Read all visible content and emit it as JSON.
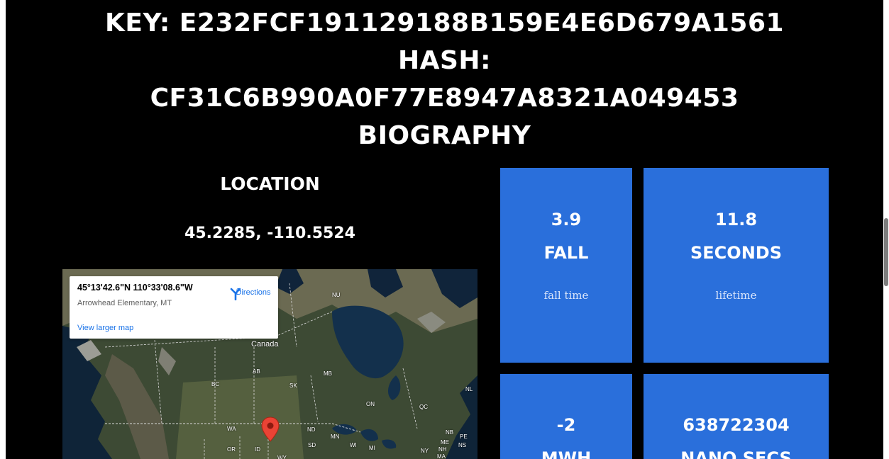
{
  "header": {
    "key_line": "KEY: E232FCF191129188B159E4E6D679A1561",
    "hash_label": "HASH:",
    "hash_value": "CF31C6B990A0F77E8947A8321A049453",
    "section_title": "BIOGRAPHY"
  },
  "location": {
    "title": "LOCATION",
    "coordinates": "45.2285, -110.5524"
  },
  "map": {
    "info_card": {
      "coords": "45°13'42.6\"N 110°33'08.6\"W",
      "place": "Arrowhead Elementary, MT",
      "directions_label": "Directions",
      "larger_map_link": "View larger map",
      "directions_icon": "directions-icon"
    },
    "labels": {
      "country": "Canada",
      "nu": "NU",
      "ab": "AB",
      "bc": "BC",
      "sk": "SK",
      "mb": "MB",
      "on": "ON",
      "qc": "QC",
      "nl": "NL",
      "nb": "NB",
      "pe": "PE",
      "ns": "NS",
      "me": "ME",
      "nh": "NH",
      "ny": "NY",
      "ma": "MA",
      "mi": "MI",
      "wi": "WI",
      "mn": "MN",
      "nd": "ND",
      "sd": "SD",
      "wa": "WA",
      "or": "OR",
      "id": "ID",
      "wy": "WY"
    },
    "marker_icon": "map-pin-icon"
  },
  "stats": [
    {
      "value": "3.9",
      "unit": "FALL",
      "desc": "fall time"
    },
    {
      "value": "11.8",
      "unit": "SECONDS",
      "desc": "lifetime"
    },
    {
      "value": "-2",
      "unit": "MWH",
      "desc": ""
    },
    {
      "value": "638722304",
      "unit": "NANO SECS",
      "desc": ""
    }
  ],
  "colors": {
    "page_bg": "#000000",
    "tile_bg": "#2a6fdb",
    "link": "#1a73e8"
  }
}
